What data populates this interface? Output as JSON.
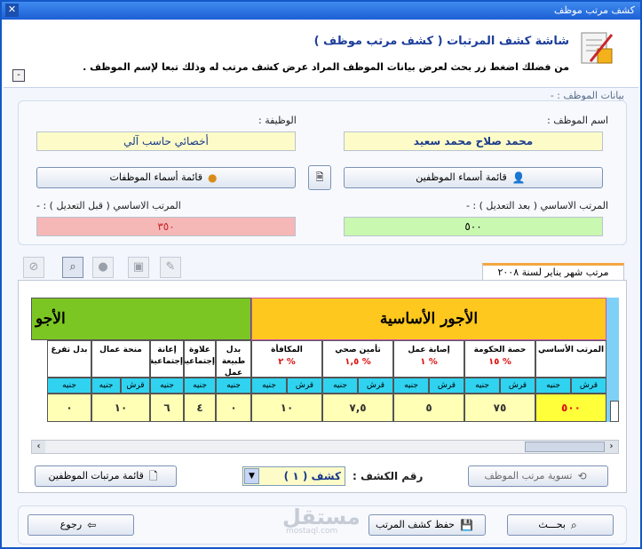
{
  "window": {
    "title": "كشف مرتب موظف",
    "close": "✕"
  },
  "header": {
    "title": "شاشة كشف المرتبات ( كشف مرتب موظف )",
    "subtitle": "من فضلك اضغط زر بحث لعرض بيانات الموظف المراد عرض كشف مرتب له وذلك تبعا لإسم الموظف .",
    "collapse": "-"
  },
  "employee": {
    "section_label": "بيانات الموظف : -",
    "name_label": "اسم الموظف :",
    "name_value": "محمد صلاح محمد سعيد",
    "job_label": "الوظيفة :",
    "job_value": "أخصائي حاسب آلي",
    "employees_btn": "قائمة أسماء الموظفين",
    "jobs_btn": "قائمة أسماء الموظفات",
    "base_after_label": "المرتب الاساسي ( بعد التعديل ) : -",
    "base_after_value": "٥٠٠",
    "base_before_label": "المرتب الاساسي ( قبل التعديل ) : -",
    "base_before_value": "٣٥٠"
  },
  "tab": {
    "label": "مرتب شهر يناير لسنة ٢٠٠٨"
  },
  "grid": {
    "group_basic": "الأجور الأساسية",
    "group_other": "الأجو",
    "columns": [
      {
        "title": "المرتب الأساسي",
        "pct": "",
        "value": "٥٠٠"
      },
      {
        "title": "حصة الحكومة",
        "pct": "% ١٥",
        "value": "٧٥"
      },
      {
        "title": "إصابة عمل",
        "pct": "% ١",
        "value": "٥"
      },
      {
        "title": "تأمين صحي",
        "pct": "% ١,٥",
        "value": "٧,٥"
      },
      {
        "title": "المكافأة",
        "pct": "% ٢",
        "value": "١٠"
      },
      {
        "title": "بدل طبيعة عمل",
        "pct": "",
        "value": "٠"
      },
      {
        "title": "علاوة إجتماعية",
        "pct": "",
        "value": "٤"
      },
      {
        "title": "إعانة إجتماعية",
        "pct": "",
        "value": "٦"
      },
      {
        "title": "منحة عمال",
        "pct": "",
        "value": "١٠"
      },
      {
        "title": "بدل تفرغ",
        "pct": "",
        "value": "٠"
      }
    ],
    "sub_pound": "جنيه",
    "sub_piaster": "قرش"
  },
  "controls": {
    "settle_btn": "تسوية مرتب الموظف",
    "sheet_label": "رقم الكشف :",
    "sheet_value": "كشف ( ١ )",
    "salaries_btn": "قائمة مرتبات الموظفين"
  },
  "footer": {
    "search_btn": "بحـــث",
    "save_btn": "حفظ كشف المرتب",
    "back_btn": "رجوع"
  },
  "watermark": {
    "text": "مستقل",
    "sub": "mostaql.com"
  }
}
